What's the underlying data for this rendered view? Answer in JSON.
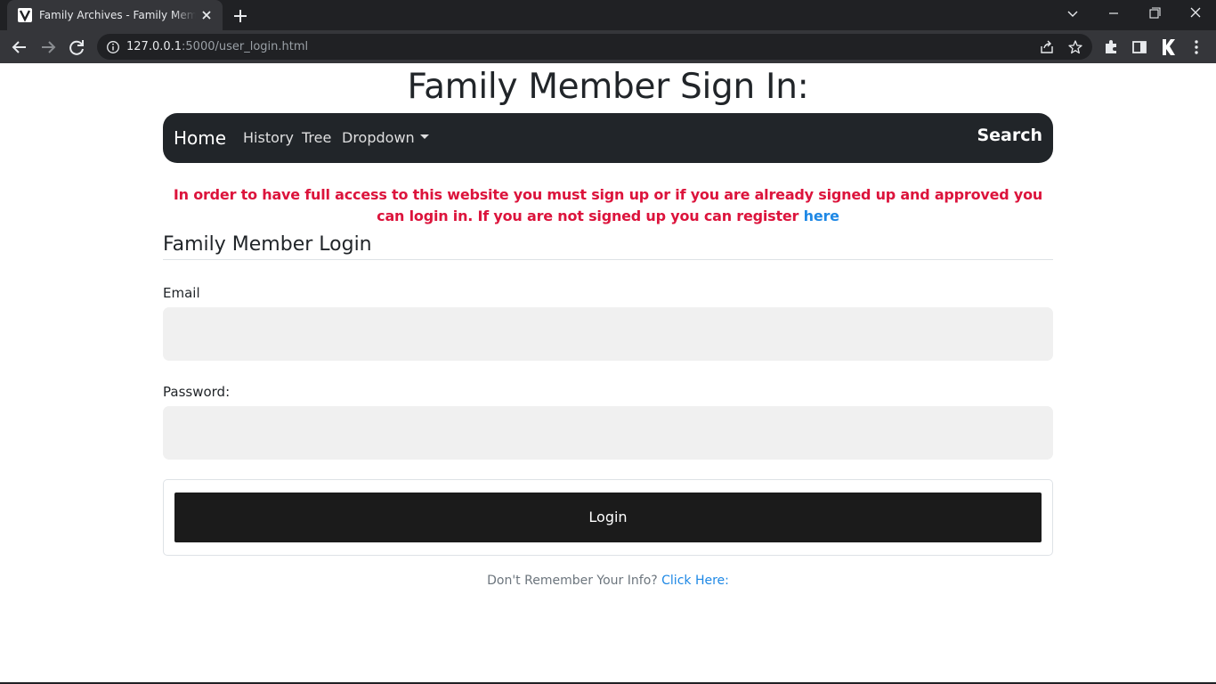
{
  "browser": {
    "tab_title": "Family Archives - Family Member Sign In",
    "url_host": "127.0.0.1",
    "url_rest": ":5000/user_login.html"
  },
  "page": {
    "title": "Family Member Sign In:"
  },
  "navbar": {
    "brand": "Home",
    "links": [
      "History",
      "Tree",
      "Dropdown"
    ],
    "search": "Search"
  },
  "notice": {
    "text": "In order to have full access to this website you must sign up or if you are already signed up and approved you can login in. If you are not signed up you can register ",
    "link": "here",
    "color": "#dc143c"
  },
  "form": {
    "section_title": "Family Member Login",
    "email_label": "Email",
    "email_value": "",
    "password_label": "Password:",
    "password_value": "",
    "login_button": "Login"
  },
  "footer": {
    "forgot_text": "Don't Remember Your Info? ",
    "forgot_link": "Click Here:"
  },
  "colors": {
    "navbar_bg": "#212529",
    "link": "#1e88e5",
    "button_bg": "#1b1b1b"
  }
}
